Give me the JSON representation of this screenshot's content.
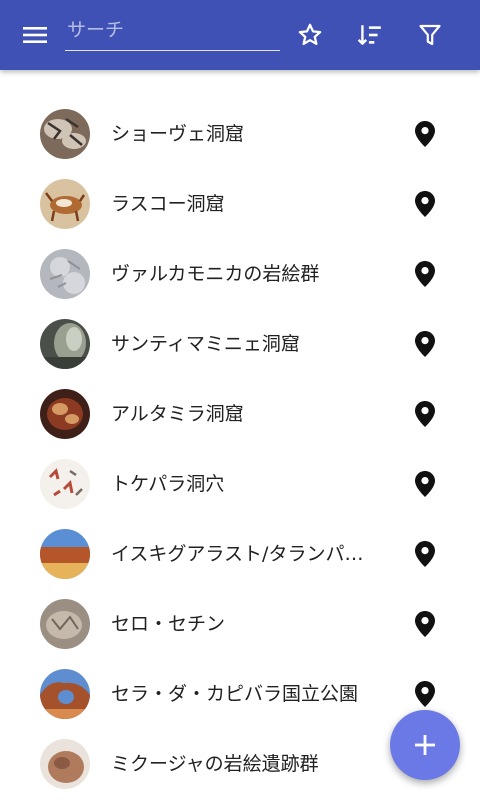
{
  "toolbar": {
    "search_placeholder": "サーチ",
    "background_color": "#3f51b5",
    "icons": [
      "menu-icon",
      "star-icon",
      "sort-icon",
      "filter-icon"
    ]
  },
  "list": {
    "items": [
      {
        "title": "ショーヴェ洞窟",
        "thumb_colors": [
          "#7d6a5a",
          "#cfc4b6",
          "#3a3330"
        ],
        "icon": "location-pin-icon"
      },
      {
        "title": "ラスコー洞窟",
        "thumb_colors": [
          "#d9c2a0",
          "#b06a32",
          "#f2e6d4"
        ],
        "icon": "location-pin-icon"
      },
      {
        "title": "ヴァルカモニカの岩絵群",
        "thumb_colors": [
          "#b5b7be",
          "#d6d7dc",
          "#8f929a"
        ],
        "icon": "location-pin-icon"
      },
      {
        "title": "サンティマミニェ洞窟",
        "thumb_colors": [
          "#4a4f49",
          "#9aa08f",
          "#c9cfc2"
        ],
        "icon": "location-pin-icon"
      },
      {
        "title": "アルタミラ洞窟",
        "thumb_colors": [
          "#8c3a22",
          "#d59a64",
          "#3f2018"
        ],
        "icon": "location-pin-icon"
      },
      {
        "title": "トケパラ洞穴",
        "thumb_colors": [
          "#f4f1ec",
          "#b84a3a",
          "#7a6a60"
        ],
        "icon": "location-pin-icon"
      },
      {
        "title": "イスキグアラスト/タランパヤ自然公園群",
        "thumb_colors": [
          "#5a8fd6",
          "#b4552a",
          "#e6b35a"
        ],
        "icon": "location-pin-icon"
      },
      {
        "title": "セロ・セチン",
        "thumb_colors": [
          "#9a8f82",
          "#c4b9aa",
          "#6f665c"
        ],
        "icon": "location-pin-icon"
      },
      {
        "title": "セラ・ダ・カピバラ国立公園",
        "thumb_colors": [
          "#5f8ed0",
          "#a4512c",
          "#d98a4e"
        ],
        "icon": "location-pin-icon"
      },
      {
        "title": "ミクージャの岩絵遺跡群",
        "thumb_colors": [
          "#e9e3dc",
          "#b07a5c",
          "#8a5a44"
        ],
        "icon": "location-pin-icon"
      }
    ]
  },
  "fab": {
    "icon": "plus-icon",
    "color": "#6b79e6"
  }
}
